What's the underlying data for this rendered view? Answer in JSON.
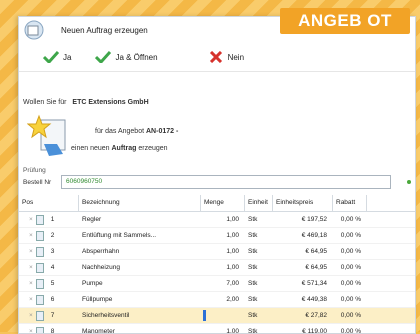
{
  "badge": "ANGEB OT",
  "window": {
    "title": "Neuen Auftrag erzeugen"
  },
  "toolbar": {
    "ja_label": "Ja",
    "ja_oeffnen_label": "Ja & Öffnen",
    "nein_label": "Nein"
  },
  "dialog": {
    "waehlen_prefix": "Wollen Sie für",
    "customer": "ETC Extensions GmbH",
    "angebot_prefix": "für das Angebot",
    "angebot_no": "AN-0172 -",
    "auftrag_prefix": "einen neuen",
    "auftrag_word": "Auftrag",
    "auftrag_suffix": "erzeugen",
    "pruefung_label": "Prüfung",
    "bestell_label": "Bestell Nr",
    "bestell_value": "6060960750"
  },
  "table": {
    "headers": [
      "Pos",
      "Bezeichnung",
      "Menge",
      "Einheit",
      "Einheitspreis",
      "Rabatt"
    ],
    "rows": [
      {
        "pos": "1",
        "bez": "Regler",
        "menge": "1,00",
        "einheit": "Stk",
        "preis": "€ 197,52",
        "rabatt": "0,00 %"
      },
      {
        "pos": "2",
        "bez": "Entlüftung mit Sammels...",
        "menge": "1,00",
        "einheit": "Stk",
        "preis": "€ 469,18",
        "rabatt": "0,00 %"
      },
      {
        "pos": "3",
        "bez": "Absperrhahn",
        "menge": "1,00",
        "einheit": "Stk",
        "preis": "€ 64,95",
        "rabatt": "0,00 %"
      },
      {
        "pos": "4",
        "bez": "Nachheizung",
        "menge": "1,00",
        "einheit": "Stk",
        "preis": "€ 64,95",
        "rabatt": "0,00 %"
      },
      {
        "pos": "5",
        "bez": "Pumpe",
        "menge": "7,00",
        "einheit": "Stk",
        "preis": "€ 571,34",
        "rabatt": "0,00 %"
      },
      {
        "pos": "6",
        "bez": "Füllpumpe",
        "menge": "2,00",
        "einheit": "Stk",
        "preis": "€ 449,38",
        "rabatt": "0,00 %"
      },
      {
        "pos": "7",
        "bez": "Sicherheitsventil",
        "menge": "",
        "einheit": "Stk",
        "preis": "€ 27,82",
        "rabatt": "0,00 %"
      },
      {
        "pos": "8",
        "bez": "Manometer",
        "menge": "1,00",
        "einheit": "Stk",
        "preis": "€ 119,00",
        "rabatt": "0,00 %"
      }
    ]
  }
}
